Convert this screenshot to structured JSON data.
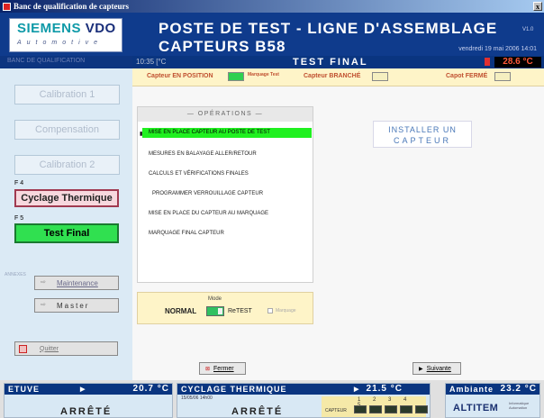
{
  "window": {
    "title": "Banc de qualification de capteurs",
    "close_label": "x"
  },
  "header": {
    "logo_brand": "SIEMENS",
    "logo_brand2": "VDO",
    "logo_tagline": "Automotive",
    "title": "POSTE DE TEST - LIGNE D'ASSEMBLAGE CAPTEURS B58",
    "version": "V1.0",
    "date": "vendredi 19 mai 2006  14:01"
  },
  "sidebar": {
    "top_strip": "BANC DE QUALIFICATION",
    "buttons": [
      {
        "label": "Calibration 1",
        "fkey": ""
      },
      {
        "label": "Compensation",
        "fkey": ""
      },
      {
        "label": "Calibration 2",
        "fkey": ""
      },
      {
        "label": "Cyclage Thermique",
        "fkey": "F 4"
      },
      {
        "label": "Test Final",
        "fkey": "F 5"
      }
    ],
    "annexes_label": "ANNEXES",
    "maintenance_label": "Maintenance",
    "master_label": "Master",
    "quit_label": "Quitter"
  },
  "status": {
    "time": "10:35 [°C",
    "mode_title": "TEST FINAL",
    "temperature": "28.6 °C"
  },
  "indicators": {
    "capteur_position": "Capteur EN POSITION",
    "capteur_position_on": true,
    "marquage_test": "Marquage Test",
    "capteur_branche": "Capteur BRANCHÉ",
    "capot_ferme": "Capot FERMÉ"
  },
  "operations": {
    "header": "— OPÉRATIONS —",
    "items": [
      {
        "label": "MISE EN PLACE CAPTEUR AU POSTE DE TEST",
        "active": true
      },
      {
        "label": "MESURES EN BALAYAGE ALLER/RETOUR",
        "active": false
      },
      {
        "label": "CALCULS ET VÉRIFICATIONS FINALES",
        "active": false
      },
      {
        "label": "PROGRAMMER VERROUILLAGE CAPTEUR",
        "active": false
      },
      {
        "label": "MISE EN PLACE DU CAPTEUR AU MARQUAGE",
        "active": false
      },
      {
        "label": "MARQUAGE FINAL CAPTEUR",
        "active": false
      }
    ]
  },
  "instruction": {
    "line1": "INSTALLER UN",
    "line2": "CAPTEUR"
  },
  "mode": {
    "label": "Mode",
    "normal": "NORMAL",
    "retest": "ReTEST",
    "marquage": "Marquage",
    "toggle_state": "on"
  },
  "nav": {
    "close_label": "Fermer",
    "next_label": "Suivante"
  },
  "bottom": {
    "etuve": {
      "title": "ETUVE",
      "temp": "20.7 °C",
      "state": "ARRÊTÉ"
    },
    "cyclage": {
      "title": "CYCLAGE THERMIQUE",
      "temp": "21.5 °C",
      "state": "ARRÊTÉ",
      "sub": "15/05/06 14h00",
      "capteur_label": "CAPTEUR",
      "capteur_nums": "1 2 3 4 5"
    },
    "ambiante": {
      "title": "Ambiante",
      "temp": "23.2 °C",
      "brand": "ALTITEM",
      "brand_sub": "Informatique Automation"
    }
  },
  "colors": {
    "navy": "#0a3580",
    "active_green": "#20f020",
    "temp_red": "#ff5a3a",
    "pale_yellow": "#fef4c8"
  }
}
